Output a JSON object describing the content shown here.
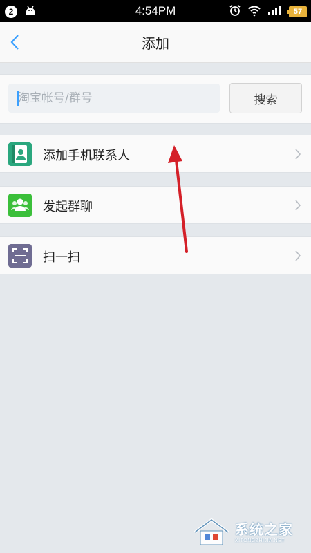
{
  "status_bar": {
    "notification_count": "2",
    "time": "4:54PM",
    "battery": "57",
    "icons": [
      "android-icon",
      "alarm-icon",
      "wifi-icon",
      "signal-icon",
      "battery-icon"
    ]
  },
  "header": {
    "title": "添加",
    "back_icon": "chevron-left-icon"
  },
  "search": {
    "placeholder": "淘宝帐号/群号",
    "value": "",
    "button_label": "搜索"
  },
  "menu": {
    "items": [
      {
        "label": "添加手机联系人",
        "icon": "contact-card-icon",
        "icon_color": "#2aa77e"
      },
      {
        "label": "发起群聊",
        "icon": "group-chat-icon",
        "icon_color": "#3bbf3a"
      },
      {
        "label": "扫一扫",
        "icon": "scan-icon",
        "icon_color": "#6f6c92"
      }
    ]
  },
  "annotation": {
    "arrow_color": "#d42028"
  },
  "watermark": {
    "text_cn": "系统之家",
    "text_en": "XITONGZHIJIA.NET"
  },
  "colors": {
    "accent": "#3aa0ff",
    "background": "#e4e8ec"
  }
}
